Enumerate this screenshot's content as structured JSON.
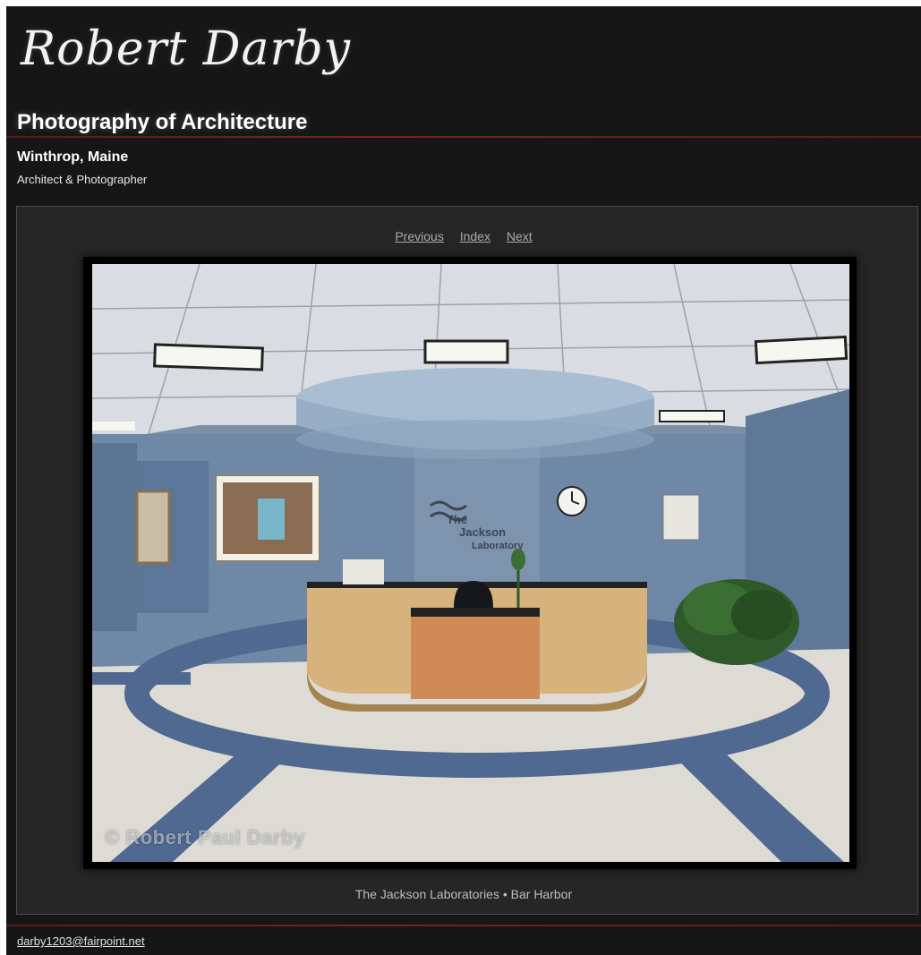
{
  "header": {
    "signature": "Robert Darby",
    "title": "Photography of Architecture",
    "location": "Winthrop, Maine",
    "role": "Architect & Photographer"
  },
  "nav": {
    "previous": "Previous",
    "index": "Index",
    "next": "Next"
  },
  "photo": {
    "watermark": "© Robert Paul Darby",
    "sign_line1": "The",
    "sign_line2": "Jackson",
    "sign_line3": "Laboratory"
  },
  "caption": "The Jackson Laboratories • Bar Harbor",
  "footer": {
    "email": "darby1203@fairpoint.net"
  },
  "colors": {
    "page_bg": "#161616",
    "panel_bg": "#262626",
    "rule": "#7a2222",
    "nav_link": "#aaaaaa"
  }
}
